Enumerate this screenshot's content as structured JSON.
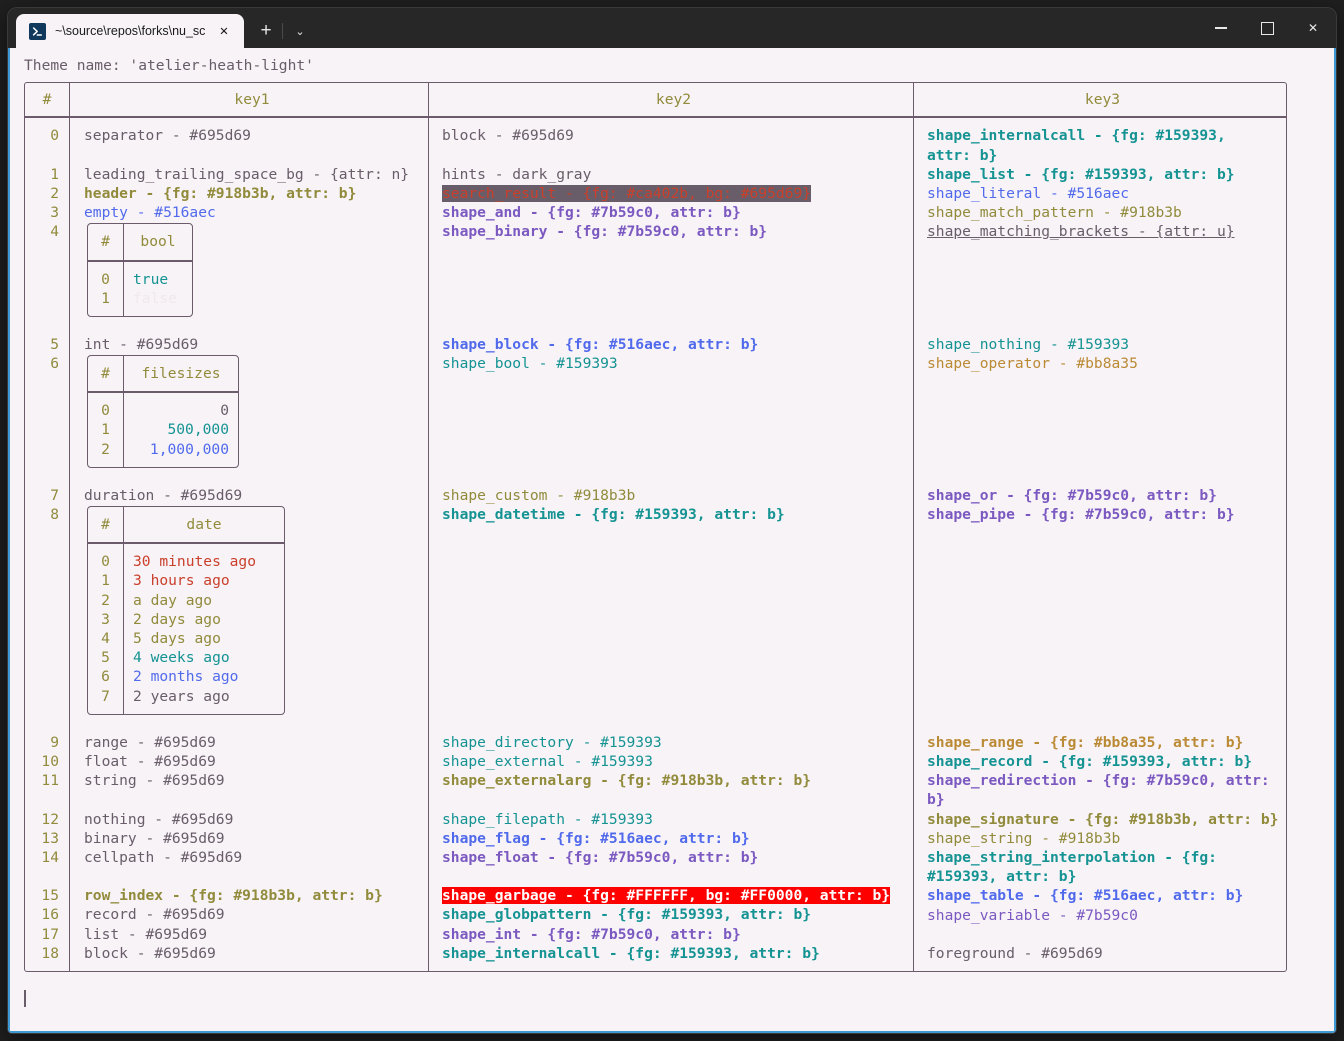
{
  "window": {
    "tab": {
      "icon": "powershell-prompt-icon",
      "title": "~\\source\\repos\\forks\\nu_scrip",
      "close_label": "✕"
    },
    "new_tab_label": "+",
    "tab_menu_label": "⌄",
    "controls": {
      "minimize": "minimize-icon",
      "maximize": "maximize-icon",
      "close_label": "✕"
    }
  },
  "terminal": {
    "theme_line": "Theme name: 'atelier-heath-light'",
    "prompt_cursor": "text-cursor"
  },
  "table": {
    "headers": [
      "#",
      "key1",
      "key2",
      "key3"
    ],
    "index_groups": [
      [
        "0",
        "",
        "1",
        "2",
        "3",
        "4"
      ],
      [
        "5",
        "6"
      ],
      [
        "7",
        "8"
      ],
      [
        "9",
        "10",
        "11",
        "",
        "12",
        "13",
        "14",
        "",
        "15",
        "16",
        "17",
        "18"
      ]
    ],
    "key1": {
      "group0": [
        "separator - #695d69",
        "leading_trailing_space_bg - {attr: n}",
        "header - {fg: #918b3b, attr: b}",
        "empty - #516aec"
      ],
      "bool_table": {
        "headers": [
          "#",
          "bool"
        ],
        "rows": [
          [
            "0",
            "true"
          ],
          [
            "1",
            "false"
          ]
        ]
      },
      "group1": [
        "int - #695d69"
      ],
      "filesizes_table": {
        "headers": [
          "#",
          "filesizes"
        ],
        "rows": [
          [
            "0",
            "0"
          ],
          [
            "1",
            "500,000"
          ],
          [
            "2",
            "1,000,000"
          ]
        ]
      },
      "group2": [
        "duration - #695d69"
      ],
      "date_table": {
        "headers": [
          "#",
          "date"
        ],
        "rows": [
          [
            "0",
            "30 minutes ago"
          ],
          [
            "1",
            "3 hours ago"
          ],
          [
            "2",
            "a day ago"
          ],
          [
            "3",
            "2 days ago"
          ],
          [
            "4",
            "5 days ago"
          ],
          [
            "5",
            "4 weeks ago"
          ],
          [
            "6",
            "2 months ago"
          ],
          [
            "7",
            "2 years ago"
          ]
        ]
      },
      "group3": [
        "range - #695d69",
        "float - #695d69",
        "string - #695d69",
        "",
        "nothing - #695d69",
        "binary - #695d69",
        "cellpath - #695d69",
        "",
        "row_index - {fg: #918b3b, attr: b}",
        "record - #695d69",
        "list - #695d69",
        "block - #695d69"
      ]
    },
    "key2": {
      "group0": [
        "block - #695d69",
        "",
        "hints - dark_gray",
        "search_result - {fg: #ca402b, bg: #695d69}",
        "shape_and - {fg: #7b59c0, attr: b}",
        "shape_binary - {fg: #7b59c0, attr: b}"
      ],
      "group1": [
        "shape_block - {fg: #516aec, attr: b}",
        "shape_bool - #159393"
      ],
      "group2": [
        "shape_custom - #918b3b",
        "shape_datetime - {fg: #159393, attr: b}"
      ],
      "group3": [
        "shape_directory - #159393",
        "shape_external - #159393",
        "shape_externalarg - {fg: #918b3b, attr: b}",
        "",
        "shape_filepath - #159393",
        "shape_flag - {fg: #516aec, attr: b}",
        "shape_float - {fg: #7b59c0, attr: b}",
        "",
        "shape_garbage - {fg: #FFFFFF, bg: #FF0000, attr: b}",
        "shape_globpattern - {fg: #159393, attr: b}",
        "shape_int - {fg: #7b59c0, attr: b}",
        "shape_internalcall - {fg: #159393, attr: b}"
      ]
    },
    "key3": {
      "group0": [
        "shape_internalcall - {fg: #159393, attr: b}",
        "shape_list - {fg: #159393, attr: b}",
        "shape_literal - #516aec",
        "shape_match_pattern - #918b3b",
        "shape_matching_brackets - {attr: u}"
      ],
      "group1": [
        "shape_nothing - #159393",
        "shape_operator - #bb8a35"
      ],
      "group2": [
        "shape_or - {fg: #7b59c0, attr: b}",
        "shape_pipe - {fg: #7b59c0, attr: b}"
      ],
      "group3": [
        "shape_range - {fg: #bb8a35, attr: b}",
        "shape_record - {fg: #159393, attr: b}",
        "shape_redirection - {fg: #7b59c0, attr: b}",
        "shape_signature - {fg: #918b3b, attr: b}",
        "shape_string - #918b3b",
        "shape_string_interpolation - {fg: #159393, attr: b}",
        "shape_table - {fg: #516aec, attr: b}",
        "shape_variable - #7b59c0",
        "",
        "foreground - #695d69"
      ]
    }
  },
  "palette": {
    "bg": "#f7f3f7",
    "fg": "#695d69",
    "border": "#6b5b6b",
    "olive": "#918b3b",
    "blue": "#516aec",
    "teal": "#159393",
    "purple": "#7b59c0",
    "amber": "#bb8a35",
    "red": "#ca402b",
    "accent_border": "#3d9ad4",
    "garbage_bg": "#FF0000",
    "garbage_fg": "#FFFFFF",
    "search_bg": "#695d69",
    "search_fg": "#ca402b"
  }
}
